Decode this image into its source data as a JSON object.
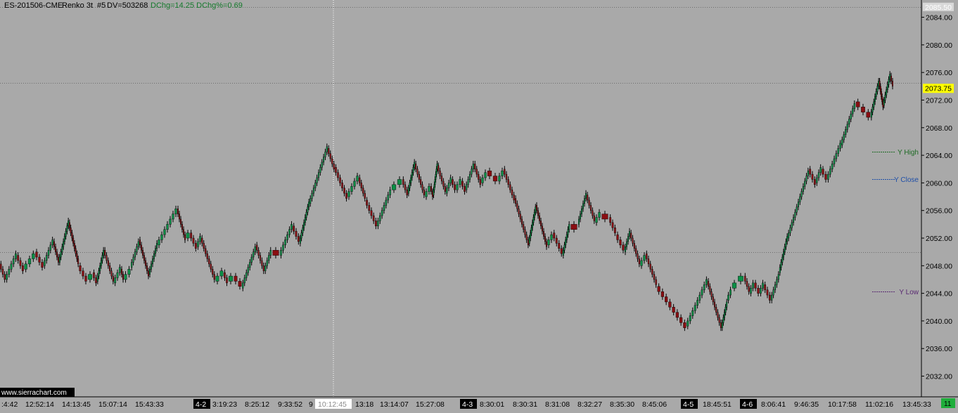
{
  "header": {
    "symbol": "ES-201506-CME",
    "bar_type": "Renko 3t",
    "chart_number": "#5",
    "dv_text": "DV=503268",
    "dchg_text": "DChg=14.25 DChg%=0.69"
  },
  "watermark": "www.sierrachart.com",
  "corner_label": "11",
  "colors": {
    "background": "#a9a9a9",
    "up_bar": "#0b8f46",
    "down_bar": "#8a0e12",
    "wick": "#000000",
    "header_text": "#000000",
    "dchg_text": "#157a2c",
    "y_high": "#1e6b24",
    "y_close": "#1f4fa8",
    "y_low": "#5a2a73",
    "last_price_bg": "#ffff00"
  },
  "chart_data": {
    "type": "renko",
    "brick_size": 0.75,
    "ylim": [
      2029.0,
      2086.5
    ],
    "y_ticks": [
      2032.0,
      2036.0,
      2040.0,
      2044.0,
      2048.0,
      2052.0,
      2056.0,
      2060.0,
      2064.0,
      2068.0,
      2072.0,
      2076.0,
      2080.0,
      2084.0
    ],
    "top_price_label": "2085.50",
    "last_price": 2073.75,
    "last_price_label": "2073.75",
    "reference_lines": [
      {
        "name": "Y High",
        "label": "Y High",
        "value": 2064.5
      },
      {
        "name": "Y Close",
        "label": "Y Close",
        "value": 2060.5
      },
      {
        "name": "Y Low",
        "label": "Y Low",
        "value": 2044.25
      }
    ],
    "gridlines": [
      2085.5,
      2074.5,
      2050.0
    ],
    "x_labels": [
      {
        "text": ":4:42",
        "date_marker": false
      },
      {
        "text": "12:52:14",
        "date_marker": false
      },
      {
        "text": "14:13:45",
        "date_marker": false
      },
      {
        "text": "15:07:14",
        "date_marker": false
      },
      {
        "text": "15:43:33",
        "date_marker": false
      },
      {
        "text": "4-2",
        "date_marker": true
      },
      {
        "text": "3:19:23",
        "date_marker": false
      },
      {
        "text": "8:25:12",
        "date_marker": false
      },
      {
        "text": "9:33:52",
        "date_marker": false
      },
      {
        "text": "9",
        "date_marker": false
      },
      {
        "text": "10:12:45",
        "date_marker": false,
        "cursor": true
      },
      {
        "text": "13:18",
        "date_marker": false
      },
      {
        "text": "13:14:07",
        "date_marker": false
      },
      {
        "text": "15:27:08",
        "date_marker": false
      },
      {
        "text": "4-3",
        "date_marker": true
      },
      {
        "text": "8:30:01",
        "date_marker": false
      },
      {
        "text": "8:30:31",
        "date_marker": false
      },
      {
        "text": "8:31:08",
        "date_marker": false
      },
      {
        "text": "8:32:27",
        "date_marker": false
      },
      {
        "text": "8:35:30",
        "date_marker": false
      },
      {
        "text": "8:45:06",
        "date_marker": false
      },
      {
        "text": "4-5",
        "date_marker": true
      },
      {
        "text": "18:45:51",
        "date_marker": false
      },
      {
        "text": "4-6",
        "date_marker": true
      },
      {
        "text": "8:06:41",
        "date_marker": false
      },
      {
        "text": "9:46:35",
        "date_marker": false
      },
      {
        "text": "10:17:58",
        "date_marker": false
      },
      {
        "text": "11:02:16",
        "date_marker": false
      },
      {
        "text": "13:45:33",
        "date_marker": false
      }
    ],
    "path_points": [
      [
        2048.25,
        0
      ],
      [
        2046.0,
        8
      ],
      [
        2049.5,
        24
      ],
      [
        2047.5,
        34
      ],
      [
        2050.0,
        50
      ],
      [
        2048.0,
        62
      ],
      [
        2051.5,
        76
      ],
      [
        2048.5,
        84
      ],
      [
        2054.25,
        98
      ],
      [
        2048.0,
        112
      ],
      [
        2046.0,
        124
      ],
      [
        2047.0,
        132
      ],
      [
        2045.75,
        138
      ],
      [
        2050.25,
        148
      ],
      [
        2045.5,
        162
      ],
      [
        2047.5,
        172
      ],
      [
        2046.0,
        176
      ],
      [
        2047.75,
        186
      ],
      [
        2051.75,
        198
      ],
      [
        2046.75,
        212
      ],
      [
        2051.0,
        224
      ],
      [
        2056.25,
        252
      ],
      [
        2052.0,
        264
      ],
      [
        2052.75,
        270
      ],
      [
        2050.75,
        280
      ],
      [
        2052.0,
        286
      ],
      [
        2045.75,
        306
      ],
      [
        2047.0,
        318
      ],
      [
        2045.75,
        324
      ],
      [
        2046.5,
        332
      ],
      [
        2044.75,
        344
      ],
      [
        2051.0,
        364
      ],
      [
        2047.25,
        376
      ],
      [
        2050.25,
        386
      ],
      [
        2049.5,
        398
      ],
      [
        2053.75,
        416
      ],
      [
        2051.25,
        426
      ],
      [
        2057.0,
        440
      ],
      [
        2065.0,
        466
      ],
      [
        2062.25,
        476
      ],
      [
        2058.0,
        494
      ],
      [
        2060.75,
        510
      ],
      [
        2057.5,
        520
      ],
      [
        2053.75,
        536
      ],
      [
        2059.0,
        556
      ],
      [
        2060.5,
        572
      ],
      [
        2058.5,
        580
      ],
      [
        2062.75,
        590
      ],
      [
        2058.0,
        604
      ],
      [
        2059.5,
        612
      ],
      [
        2058.25,
        616
      ],
      [
        2062.5,
        622
      ],
      [
        2058.5,
        634
      ],
      [
        2060.5,
        642
      ],
      [
        2059.0,
        648
      ],
      [
        2060.25,
        656
      ],
      [
        2059.0,
        662
      ],
      [
        2062.75,
        674
      ],
      [
        2060.0,
        684
      ],
      [
        2061.75,
        692
      ],
      [
        2060.25,
        708
      ],
      [
        2062.0,
        716
      ],
      [
        2057.75,
        732
      ],
      [
        2051.25,
        752
      ],
      [
        2056.75,
        762
      ],
      [
        2051.0,
        778
      ],
      [
        2052.75,
        786
      ],
      [
        2049.5,
        800
      ],
      [
        2054.0,
        810
      ],
      [
        2054.0,
        822
      ],
      [
        2058.25,
        834
      ],
      [
        2054.25,
        846
      ],
      [
        2055.5,
        854
      ],
      [
        2055.0,
        866
      ],
      [
        2052.5,
        876
      ],
      [
        2050.0,
        888
      ],
      [
        2052.75,
        896
      ],
      [
        2048.0,
        910
      ],
      [
        2049.75,
        918
      ],
      [
        2045.0,
        934
      ],
      [
        2039.25,
        976
      ],
      [
        2042.25,
        990
      ],
      [
        2045.75,
        1006
      ],
      [
        2039.0,
        1026
      ],
      [
        2043.0,
        1034
      ],
      [
        2044.75,
        1040
      ],
      [
        2045.75,
        1048
      ],
      [
        2046.5,
        1058
      ],
      [
        2044.0,
        1066
      ],
      [
        2045.5,
        1072
      ],
      [
        2044.0,
        1080
      ],
      [
        2045.25,
        1086
      ],
      [
        2043.0,
        1096
      ],
      [
        2047.0,
        1108
      ],
      [
        2052.0,
        1120
      ],
      [
        2062.0,
        1150
      ],
      [
        2060.0,
        1160
      ],
      [
        2062.0,
        1168
      ],
      [
        2060.5,
        1176
      ],
      [
        2065.5,
        1196
      ],
      [
        2071.75,
        1216
      ],
      [
        2069.5,
        1238
      ],
      [
        2074.75,
        1250
      ],
      [
        2071.25,
        1256
      ],
      [
        2075.5,
        1266
      ],
      [
        2073.75,
        1270
      ]
    ]
  }
}
